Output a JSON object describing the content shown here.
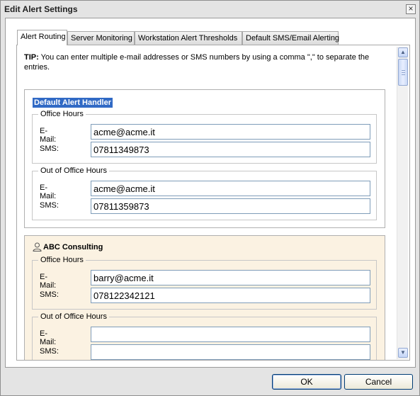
{
  "window": {
    "title": "Edit Alert Settings",
    "close_glyph": "×"
  },
  "tabs": [
    {
      "label": "Alert Routing",
      "active": true
    },
    {
      "label": "Server Monitoring",
      "active": false
    },
    {
      "label": "Workstation Alert Thresholds",
      "active": false
    },
    {
      "label": "Default SMS/Email Alerting",
      "active": false
    }
  ],
  "tip": {
    "prefix": "TIP:",
    "text": " You can enter multiple e-mail addresses or SMS numbers by using a comma \",\" to separate the entries."
  },
  "handlers": {
    "default": {
      "title": "Default Alert Handler",
      "office_hours": {
        "legend": "Office Hours",
        "email_label": "E-Mail:",
        "email": "acme@acme.it",
        "sms_label": "SMS:",
        "sms": "07811349873"
      },
      "out_of_office": {
        "legend": "Out of Office Hours",
        "email_label": "E-Mail:",
        "email": "acme@acme.it",
        "sms_label": "SMS:",
        "sms": "07811359873"
      }
    },
    "abc": {
      "title": "ABC Consulting",
      "icon": "user-icon",
      "office_hours": {
        "legend": "Office Hours",
        "email_label": "E-Mail:",
        "email": "barry@acme.it",
        "sms_label": "SMS:",
        "sms": "078122342121"
      },
      "out_of_office": {
        "legend": "Out of Office Hours",
        "email_label": "E-Mail:",
        "email": "",
        "sms_label": "SMS:",
        "sms": ""
      }
    }
  },
  "buttons": {
    "ok": "OK",
    "cancel": "Cancel"
  },
  "colors": {
    "selected_header": "#316ac5",
    "named_handler_bg": "#fbf2e2"
  }
}
